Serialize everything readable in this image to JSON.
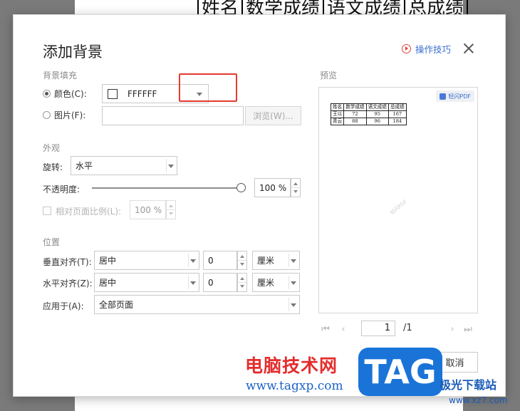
{
  "background_doc": {
    "table_headers": [
      "姓名",
      "数学成绩",
      "语文成绩",
      "总成绩"
    ]
  },
  "dialog": {
    "title": "添加背景",
    "tips_label": "操作技巧",
    "fill_section": "背景填充",
    "color_label": "颜色(C):",
    "color_value": "FFFFFF",
    "picture_label": "图片(F):",
    "picture_value": "",
    "browse_label": "浏览(W)...",
    "appearance_section": "外观",
    "rotation_label": "旋转:",
    "rotation_value": "水平",
    "opacity_label": "不透明度:",
    "opacity_value": "100 %",
    "opacity_level": 1.0,
    "relative_scale_label": "相对页面比例(L):",
    "relative_scale_value": "100 %",
    "position_section": "位置",
    "vertical_align_label": "垂直对齐(T):",
    "vertical_align_value": "居中",
    "vertical_offset": "0",
    "vertical_unit": "厘米",
    "horizontal_align_label": "水平对齐(Z):",
    "horizontal_align_value": "居中",
    "horizontal_offset": "0",
    "horizontal_unit": "厘米",
    "apply_to_label": "应用于(A):",
    "apply_to_value": "全部页面",
    "preview_section": "预览",
    "cancel_label": "取消",
    "highlight_color": "#e53a30"
  },
  "preview": {
    "badge": "轻闪PDF",
    "watermark": "轻闪PDF",
    "table": [
      [
        "姓名",
        "数学成绩",
        "语文成绩",
        "总成绩"
      ],
      [
        "王以",
        "72",
        "95",
        "167"
      ],
      [
        "青云",
        "88",
        "96",
        "184"
      ]
    ],
    "page_current": "1",
    "page_total": "/1"
  },
  "site_watermark": {
    "title": "电脑技术网",
    "url": "www.tagxp.com",
    "logo": "TAG",
    "site_name": "极光下载站",
    "domain": "www.xz7.com"
  }
}
